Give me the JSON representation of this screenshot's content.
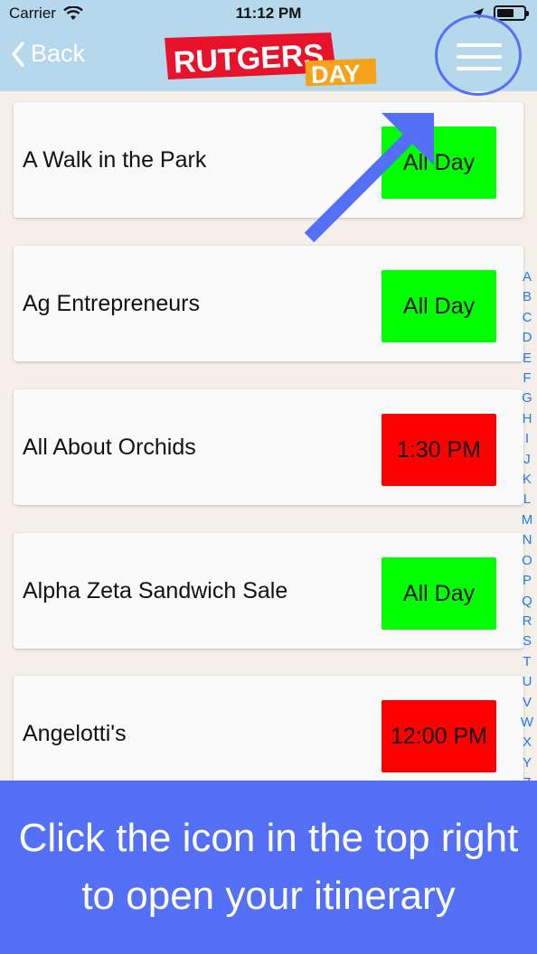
{
  "status_bar": {
    "carrier": "Carrier",
    "time": "11:12 PM",
    "battery_level": 0.65
  },
  "nav": {
    "back_label": "Back",
    "logo_top": "RUTGERS",
    "logo_bottom": "DAY",
    "menu_icon": "hamburger-menu-icon"
  },
  "events": [
    {
      "title": "A Walk in the Park",
      "time": "All Day",
      "color": "#00ff00"
    },
    {
      "title": "Ag Entrepreneurs",
      "time": "All Day",
      "color": "#00ff00"
    },
    {
      "title": "All About Orchids",
      "time": "1:30 PM",
      "color": "#ff0000"
    },
    {
      "title": "Alpha Zeta Sandwich Sale",
      "time": "All Day",
      "color": "#00ff00"
    },
    {
      "title": "Angelotti's",
      "time": "12:00 PM",
      "color": "#ff0000"
    }
  ],
  "alphabet": [
    "A",
    "B",
    "C",
    "D",
    "E",
    "F",
    "G",
    "H",
    "I",
    "J",
    "K",
    "L",
    "M",
    "N",
    "O",
    "P",
    "Q",
    "R",
    "S",
    "T",
    "U",
    "V",
    "W",
    "X",
    "Y",
    "Z"
  ],
  "banner": {
    "line1": "Click the icon in the top right",
    "line2": "to open your itinerary"
  },
  "colors": {
    "accent": "#5370f7",
    "topbar": "#b5d8ec",
    "index_blue": "#1e7cf2"
  }
}
